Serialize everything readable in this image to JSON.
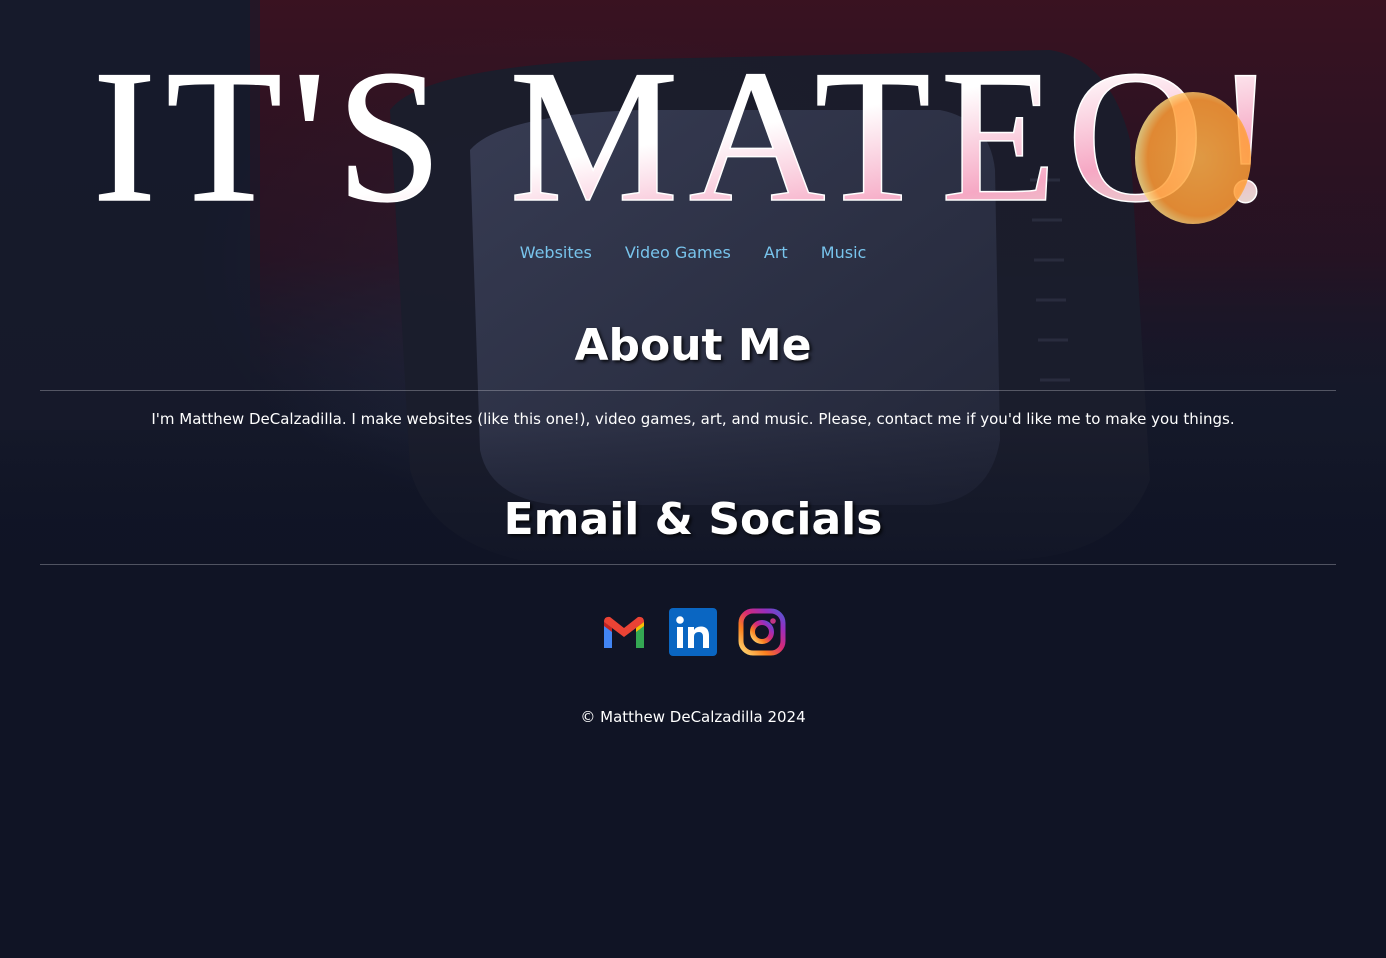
{
  "hero": {
    "title": "IT'S MATEO!"
  },
  "nav": {
    "items": [
      {
        "label": "Websites"
      },
      {
        "label": "Video Games"
      },
      {
        "label": "Art"
      },
      {
        "label": "Music"
      }
    ]
  },
  "about": {
    "heading": "About Me",
    "text": "I'm Matthew DeCalzadilla. I make websites (like this one!), video games, art, and music. Please, contact me if you'd like me to make you things."
  },
  "socials": {
    "heading": "Email & Socials",
    "links": [
      {
        "icon": "gmail-icon"
      },
      {
        "icon": "linkedin-icon"
      },
      {
        "icon": "instagram-icon"
      }
    ]
  },
  "footer": {
    "text": "© Matthew DeCalzadilla 2024"
  },
  "colors": {
    "background": "#101425",
    "nav_link": "#78c4ec",
    "accent_red": "#3a1420",
    "title_orange": "#ffa640",
    "title_pink": "#f6a8c4",
    "title_mint": "#d8f6d8"
  }
}
